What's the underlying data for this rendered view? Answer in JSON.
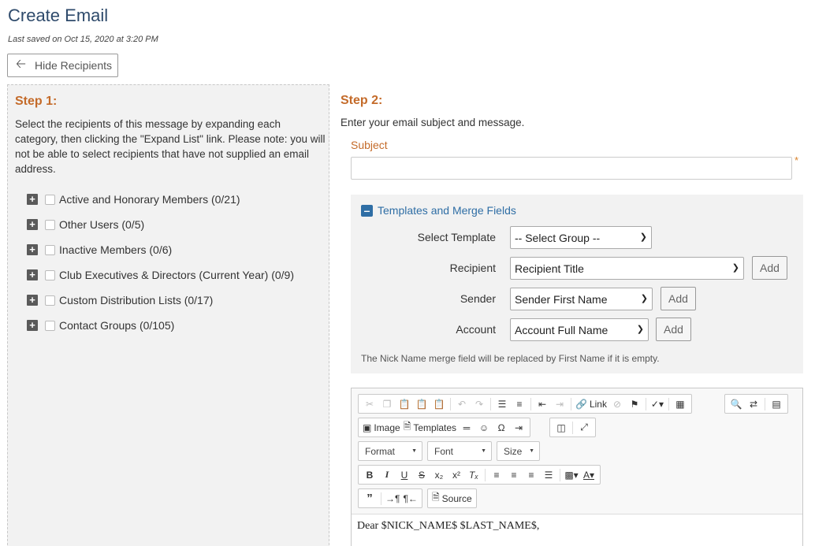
{
  "page": {
    "title": "Create Email",
    "last_saved": "Last saved on Oct 15, 2020 at 3:20 PM",
    "hide_recipients": "Hide Recipients"
  },
  "step1": {
    "title": "Step 1:",
    "description": "Select the recipients of this message by expanding each category, then clicking the \"Expand List\" link. Please note: you will not be able to select recipients that have not supplied an email address.",
    "categories": [
      {
        "label": "Active and Honorary Members (0/21)"
      },
      {
        "label": "Other Users (0/5)"
      },
      {
        "label": "Inactive Members (0/6)"
      },
      {
        "label": "Club Executives & Directors (Current Year) (0/9)"
      },
      {
        "label": "Custom Distribution Lists (0/17)"
      },
      {
        "label": "Contact Groups (0/105)"
      }
    ]
  },
  "step2": {
    "title": "Step 2:",
    "description": "Enter your email subject and message.",
    "subject_label": "Subject",
    "subject_value": "",
    "required_mark": "*"
  },
  "templates": {
    "header": "Templates and Merge Fields",
    "select_template_label": "Select Template",
    "select_template_value": "-- Select Group --",
    "recipient_label": "Recipient",
    "recipient_value": "Recipient Title",
    "sender_label": "Sender",
    "sender_value": "Sender First Name",
    "account_label": "Account",
    "account_value": "Account Full Name",
    "add_label": "Add",
    "note": "The Nick Name merge field will be replaced by First Name if it is empty."
  },
  "editor": {
    "link_label": "Link",
    "image_label": "Image",
    "templates_label": "Templates",
    "source_label": "Source",
    "format_label": "Format",
    "font_label": "Font",
    "size_label": "Size",
    "content": "Dear $NICK_NAME$ $LAST_NAME$,"
  },
  "colors": {
    "step_title": "#c46b2a",
    "page_title": "#2e4a6b",
    "link_blue": "#2f6ea5",
    "panel_bg": "#f2f2f2"
  }
}
